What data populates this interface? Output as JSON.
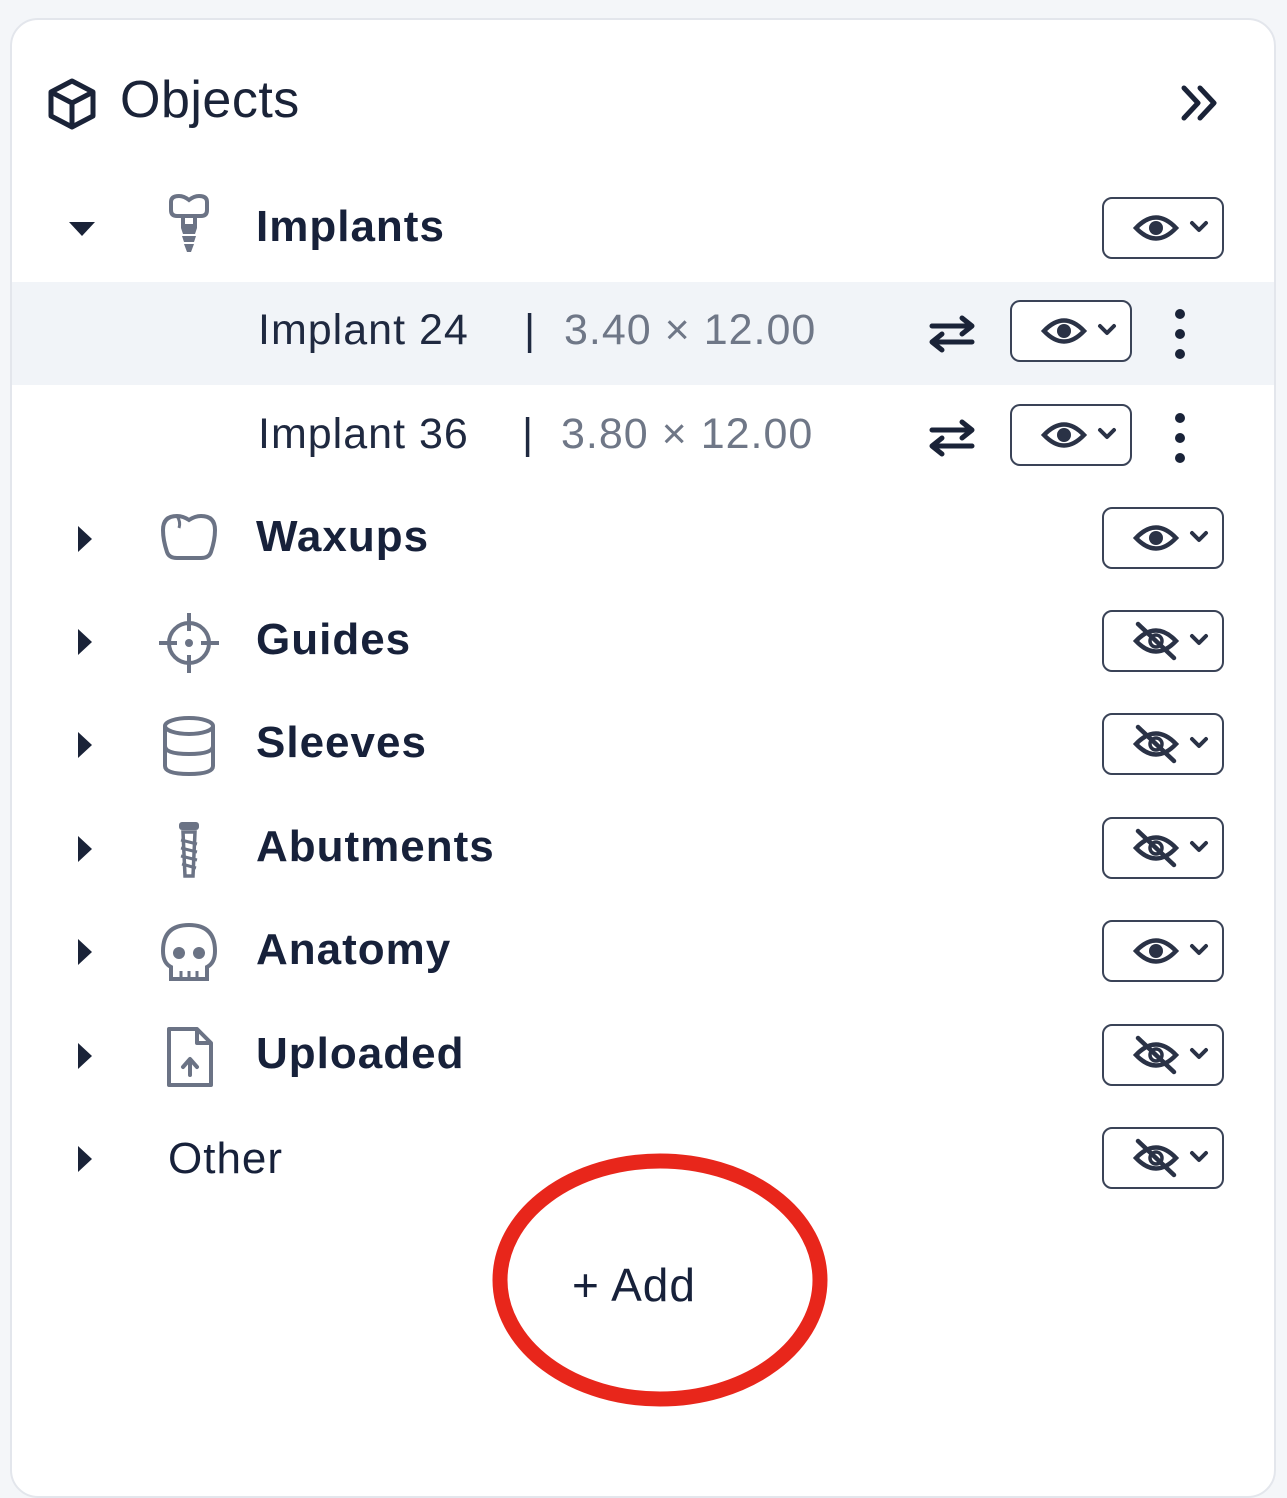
{
  "panel": {
    "title": "Objects",
    "header_icon": "cube-icon",
    "collapse_icon": "double-chevron-right-icon"
  },
  "categories": [
    {
      "label": "Implants",
      "icon": "implant-icon",
      "expanded": true,
      "visibility": "visible"
    },
    {
      "label": "Waxups",
      "icon": "tooth-icon",
      "expanded": false,
      "visibility": "visible"
    },
    {
      "label": "Guides",
      "icon": "crosshair-icon",
      "expanded": false,
      "visibility": "hidden"
    },
    {
      "label": "Sleeves",
      "icon": "cylinder-icon",
      "expanded": false,
      "visibility": "hidden"
    },
    {
      "label": "Abutments",
      "icon": "screw-icon",
      "expanded": false,
      "visibility": "hidden"
    },
    {
      "label": "Anatomy",
      "icon": "skull-icon",
      "expanded": false,
      "visibility": "visible"
    },
    {
      "label": "Uploaded",
      "icon": "file-upload-icon",
      "expanded": false,
      "visibility": "hidden"
    },
    {
      "label": "Other",
      "icon": "",
      "expanded": false,
      "visibility": "hidden"
    }
  ],
  "implants": [
    {
      "name": "Implant 24",
      "separator": "|",
      "dimensions": "3.40 × 12.00",
      "selected": true,
      "visibility": "visible"
    },
    {
      "name": "Implant 36",
      "separator": "|",
      "dimensions": "3.80 × 12.00",
      "selected": false,
      "visibility": "visible"
    }
  ],
  "add_button": {
    "label": "+ Add"
  },
  "colors": {
    "text_primary": "#17213a",
    "text_secondary": "#6f7787",
    "icon_gray": "#6b7385",
    "selected_row_bg": "#f1f4f8",
    "annotation_circle": "#e8261b"
  }
}
